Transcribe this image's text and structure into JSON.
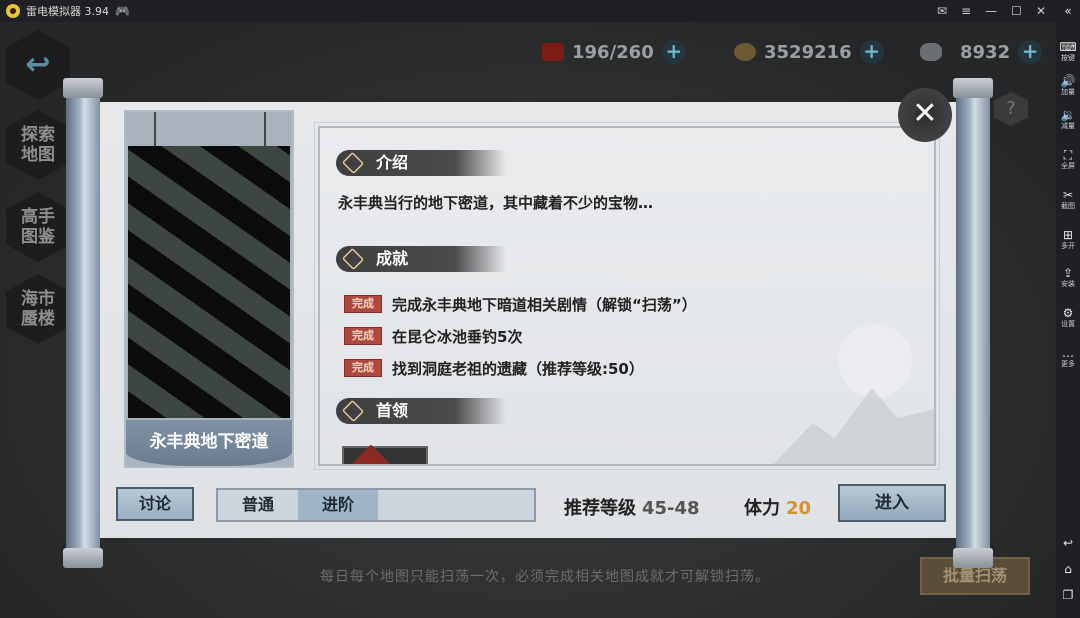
{
  "emulator": {
    "title": "雷电模拟器 3.94",
    "sidebar": [
      {
        "label": "按键",
        "icon": "keyboard-icon"
      },
      {
        "label": "加量",
        "icon": "volume-up-icon"
      },
      {
        "label": "减量",
        "icon": "volume-down-icon"
      },
      {
        "label": "全屏",
        "icon": "fullscreen-icon"
      },
      {
        "label": "截图",
        "icon": "scissors-icon"
      },
      {
        "label": "多开",
        "icon": "multi-instance-icon"
      },
      {
        "label": "安装",
        "icon": "apk-install-icon"
      },
      {
        "label": "设置",
        "icon": "gear-icon"
      },
      {
        "label": "更多",
        "icon": "more-icon"
      }
    ]
  },
  "game": {
    "left_menu": [
      "探索\n地图",
      "高手\n图鉴",
      "海市\n蜃楼"
    ],
    "resources": {
      "stamina": "196/260",
      "coins": "3529216",
      "ingots": "8932"
    },
    "help_symbol": "?",
    "bottom_hint": "每日每个地图只能扫荡一次，必须完成相关地图成就才可解锁扫荡。",
    "batch_sweep_label": "批量扫荡"
  },
  "dialog": {
    "map_name": "永丰典地下密道",
    "sections": {
      "intro_title": "介绍",
      "achievement_title": "成就",
      "boss_title": "首领"
    },
    "intro_text": "永丰典当行的地下密道，其中藏着不少的宝物…",
    "achievements": [
      {
        "badge": "完成",
        "text": "完成永丰典地下暗道相关剧情（解锁“扫荡”）"
      },
      {
        "badge": "完成",
        "text": "在昆仑冰池垂钓5次"
      },
      {
        "badge": "完成",
        "text": "找到洞庭老祖的遗藏（推荐等级:50）"
      }
    ],
    "discuss_label": "讨论",
    "modes": [
      "普通",
      "进阶"
    ],
    "active_mode": "进阶",
    "recommended_level_label": "推荐等级",
    "recommended_level_value": "45-48",
    "stamina_label": "体力",
    "stamina_value": "20",
    "enter_label": "进入",
    "close_symbol": "✕"
  }
}
